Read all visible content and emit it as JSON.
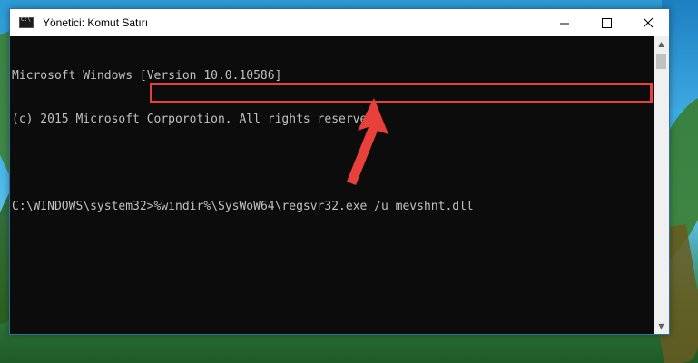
{
  "window": {
    "title": "Yönetici: Komut Satırı",
    "controls": {
      "minimize_icon": "minimize-icon",
      "maximize_icon": "maximize-icon",
      "close_icon": "close-icon"
    }
  },
  "console": {
    "lines": [
      "Microsoft Windows [Version 10.0.10586]",
      "(c) 2015 Microsoft Corporotion. All rights reserved."
    ],
    "prompt": "C:\\WINDOWS\\system32>",
    "command": "%windir%\\SysWoW64\\regsvr32.exe /u mevshnt.dll"
  },
  "colors": {
    "console_bg": "#0c0c0c",
    "console_text": "#c0c0c0",
    "highlight": "#e8403b",
    "arrow": "#e8403b"
  }
}
